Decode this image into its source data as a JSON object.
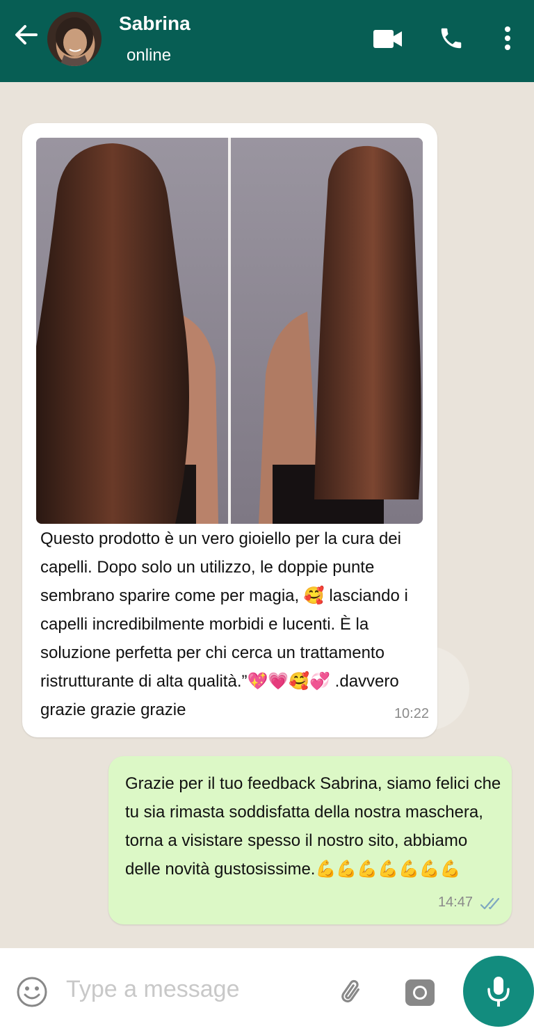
{
  "header": {
    "contact_name": "Sabrina",
    "status": "online",
    "background_color": "#075E54",
    "icons": [
      "back-arrow-icon",
      "video-camera-icon",
      "phone-icon",
      "more-vert-icon"
    ]
  },
  "messages": [
    {
      "direction": "incoming",
      "has_image": true,
      "text": "Questo prodotto è un vero gioiello per la cura dei capelli. Dopo solo un utilizzo, le doppie punte sembrano sparire come per magia, 🥰 lasciando i capelli incredibilmente morbidi e lucenti. È la soluzione perfetta per chi cerca un trattamento ristrutturante di alta qualità.”💖💗🥰💞 .davvero grazie grazie grazie",
      "time": "10:22",
      "bubble_color": "#FFFFFF"
    },
    {
      "direction": "outgoing",
      "text": "Grazie per il tuo feedback Sabrina, siamo felici che tu sia rimasta soddisfatta della nostra maschera, torna a visistare spesso il nostro sito, abbiamo delle novità gustosissime.💪💪💪💪💪💪💪",
      "time": "14:47",
      "read_receipt_icon": "double-check-icon",
      "bubble_color": "#DCF8C6"
    }
  ],
  "composer": {
    "placeholder": "Type a message",
    "icons": [
      "emoji-icon",
      "attach-icon",
      "camera-icon",
      "microphone-icon"
    ],
    "mic_button_color": "#128C7E"
  }
}
